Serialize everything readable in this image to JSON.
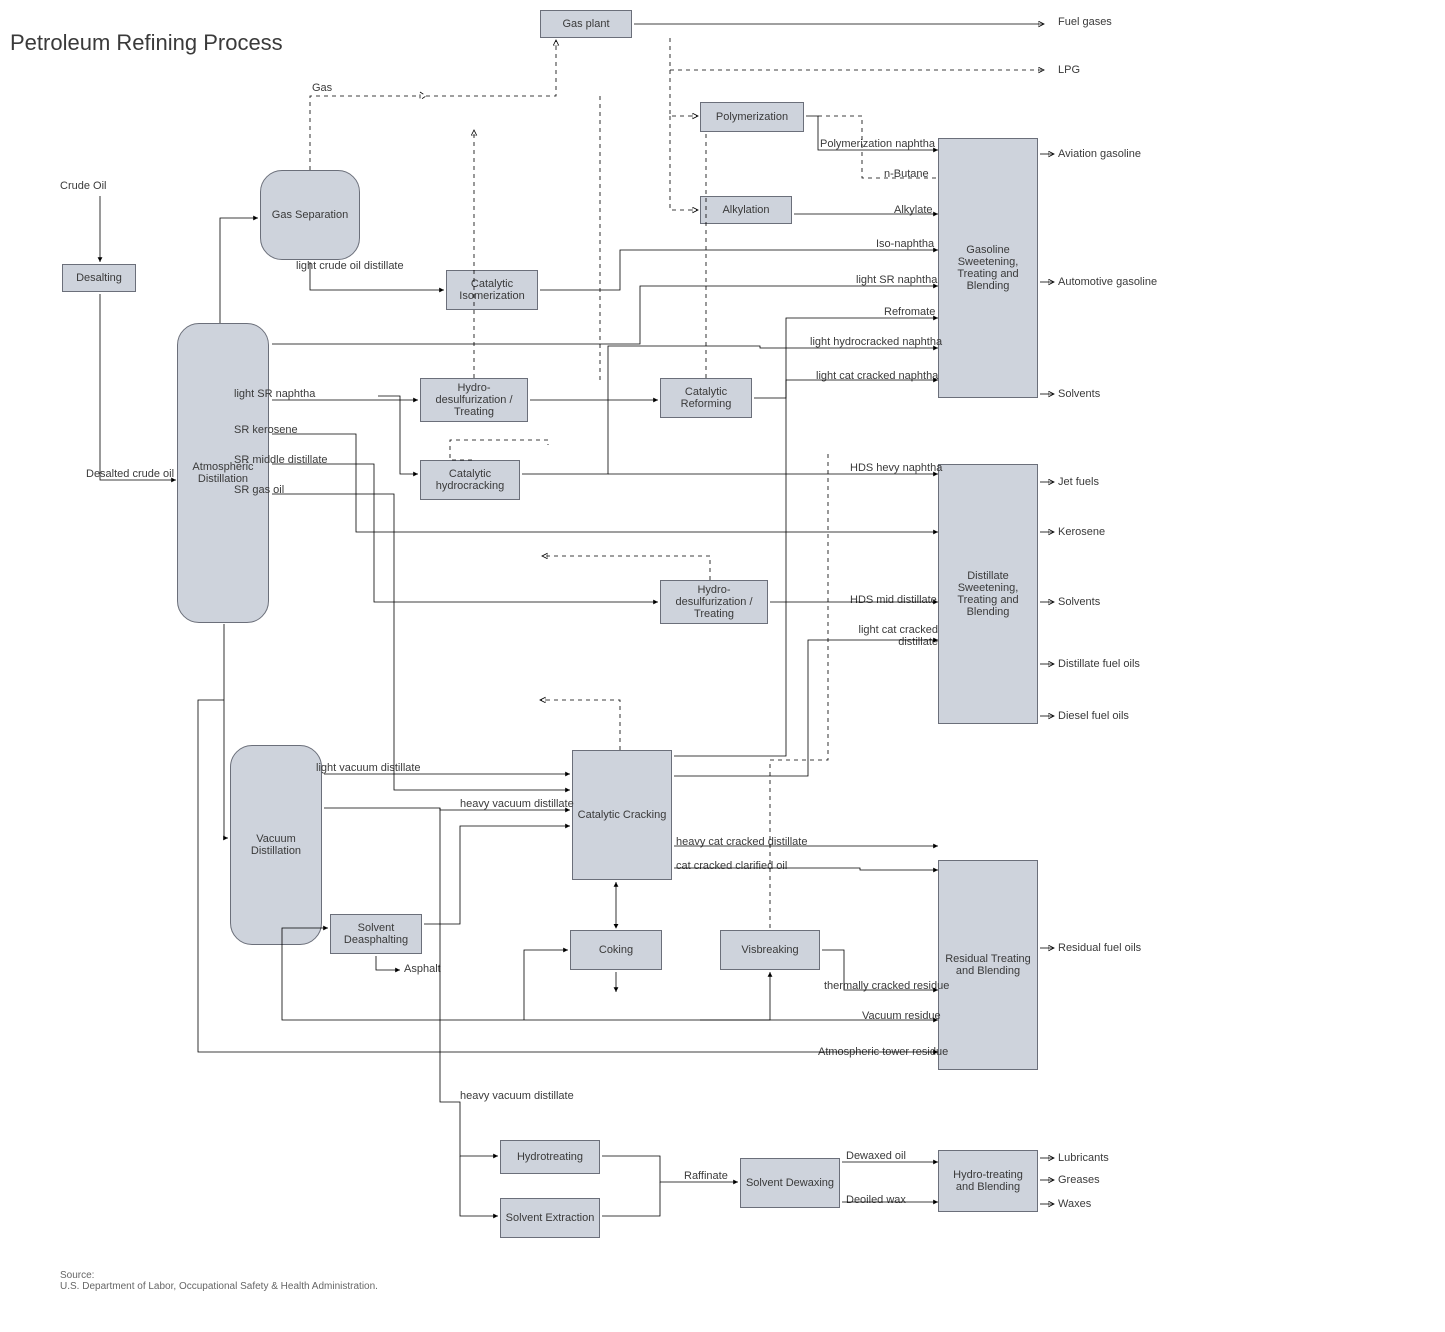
{
  "title": "Petroleum Refining Process",
  "source": "Source:\nU.S. Department of Labor, Occupational Safety & Health Administration.",
  "nodes": {
    "desalting": "Desalting",
    "gas_separation": "Gas Separation",
    "atmospheric_distillation": "Atmospheric Distillation",
    "vacuum_distillation": "Vacuum Distillation",
    "gas_plant": "Gas plant",
    "catalytic_isomerization": "Catalytic Isomerization",
    "hydro_desulf_treating1": "Hydro-desulfurization / Treating",
    "catalytic_reforming": "Catalytic Reforming",
    "catalytic_hydrocracking": "Catalytic hydrocracking",
    "hydro_desulf_treating2": "Hydro-desulfurization / Treating",
    "catalytic_cracking": "Catalytic Cracking",
    "solvent_deasphalting": "Solvent Deasphalting",
    "coking": "Coking",
    "visbreaking": "Visbreaking",
    "polymerization": "Polymerization",
    "alkylation": "Alkylation",
    "hydrotreating": "Hydrotreating",
    "solvent_extraction": "Solvent Extraction",
    "solvent_dewaxing": "Solvent Dewaxing",
    "gasoline_blend": "Gasoline Sweetening, Treating and Blending",
    "distillate_blend": "Distillate Sweetening, Treating and Blending",
    "residual_blend": "Residual Treating and Blending",
    "hydro_blend": "Hydro-treating and Blending"
  },
  "inputs": {
    "crude_oil": "Crude Oil"
  },
  "outputs": {
    "fuel_gases": "Fuel gases",
    "lpg": "LPG",
    "aviation_gasoline": "Aviation gasoline",
    "automotive_gasoline": "Automotive gasoline",
    "solvents1": "Solvents",
    "jet_fuels": "Jet fuels",
    "kerosene": "Kerosene",
    "solvents2": "Solvents",
    "distillate_fuel_oils": "Distillate fuel oils",
    "diesel_fuel_oils": "Diesel fuel oils",
    "residual_fuel_oils": "Residual fuel oils",
    "lubricants": "Lubricants",
    "greases": "Greases",
    "waxes": "Waxes",
    "asphalt": "Asphalt"
  },
  "streams": {
    "gas": "Gas",
    "light_crude_oil_distillate": "light crude oil distillate",
    "light_sr_naphtha": "light SR naphtha",
    "sr_kerosene": "SR kerosene",
    "sr_middle_distillate": "SR middle distillate",
    "sr_gas_oil": "SR gas oil",
    "desalted_crude_oil": "Desalted crude oil",
    "polymerization_naphtha": "Polymerization naphtha",
    "n_butane": "n-Butane",
    "alkylate": "Alkylate",
    "iso_naphtha": "Iso-naphtha",
    "light_sr_naphtha2": "light SR naphtha",
    "refromate": "Refromate",
    "light_hydrocracked_naphtha": "light hydrocracked naphtha",
    "light_cat_cracked_naphtha": "light cat cracked naphtha",
    "hds_heavy_naphtha": "HDS hevy naphtha",
    "hds_mid_distillate": "HDS mid distillate",
    "light_cat_cracked_distillate": "light cat cracked distillate",
    "light_vacuum_distillate": "light vacuum distillate",
    "heavy_vacuum_distillate": "heavy vacuum distillate",
    "heavy_cat_cracked_distillate": "heavy cat cracked distillate",
    "cat_cracked_clarified_oil": "cat cracked clarified oil",
    "thermally_cracked_residue": "thermally cracked residue",
    "vacuum_residue": "Vacuum residue",
    "atmospheric_tower_residue": "Atmospheric tower residue",
    "heavy_vacuum_distillate2": "heavy vacuum distillate",
    "raffinate": "Raffinate",
    "dewaxed_oil": "Dewaxed oil",
    "deoiled_wax": "Deoiled wax"
  }
}
